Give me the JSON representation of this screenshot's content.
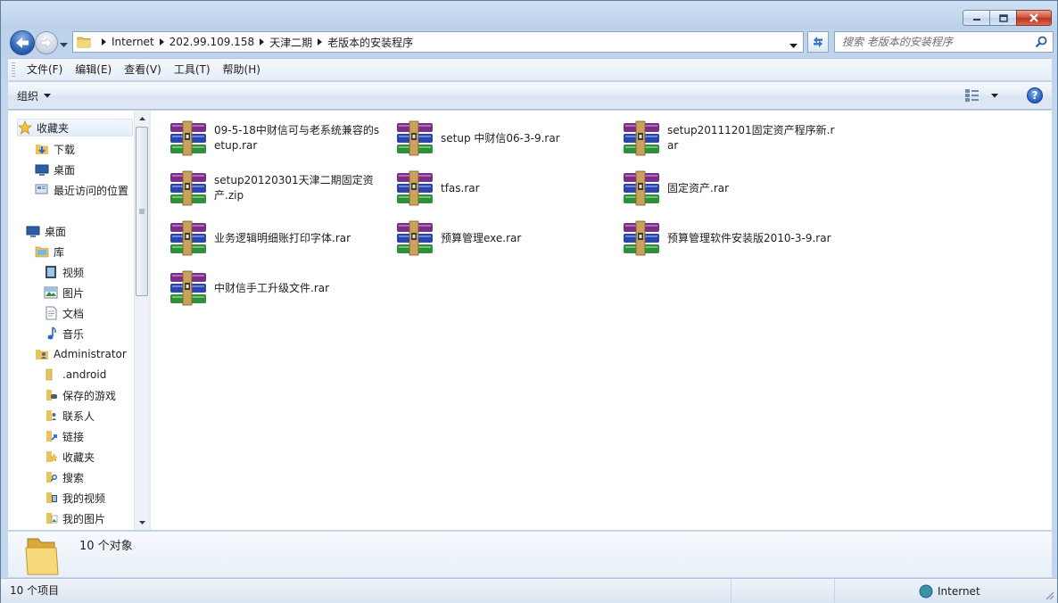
{
  "address": {
    "crumbs": [
      "Internet",
      "202.99.109.158",
      "天津二期",
      "老版本的安装程序"
    ]
  },
  "search": {
    "placeholder": "搜索 老版本的安装程序"
  },
  "menu": [
    "文件(F)",
    "编辑(E)",
    "查看(V)",
    "工具(T)",
    "帮助(H)"
  ],
  "toolbar": {
    "organize_label": "组织",
    "help_label": "?"
  },
  "nav": {
    "favorites": "收藏夹",
    "downloads": "下载",
    "desktop_fav": "桌面",
    "recent": "最近访问的位置",
    "desktop": "桌面",
    "libraries": "库",
    "videos": "视频",
    "pictures": "图片",
    "documents": "文档",
    "music": "音乐",
    "user": "Administrator",
    "android": ".android",
    "saved_games": "保存的游戏",
    "contacts": "联系人",
    "links": "链接",
    "user_favorites": "收藏夹",
    "searches": "搜索",
    "my_videos": "我的视频",
    "my_pictures": "我的图片"
  },
  "files": [
    "09-5-18中财信可与老系统兼容的setup.rar",
    "setup 中财信06-3-9.rar",
    "setup20111201固定资产程序新.rar",
    "setup20120301天津二期固定资产.zip",
    "tfas.rar",
    "固定资产.rar",
    "业务逻辑明细账打印字体.rar",
    "预算管理exe.rar",
    "预算管理软件安装版2010-3-9.rar",
    "中财信手工升级文件.rar"
  ],
  "details": {
    "count_text": "10 个对象"
  },
  "status": {
    "items_text": "10 个项目",
    "zone_text": "Internet"
  }
}
